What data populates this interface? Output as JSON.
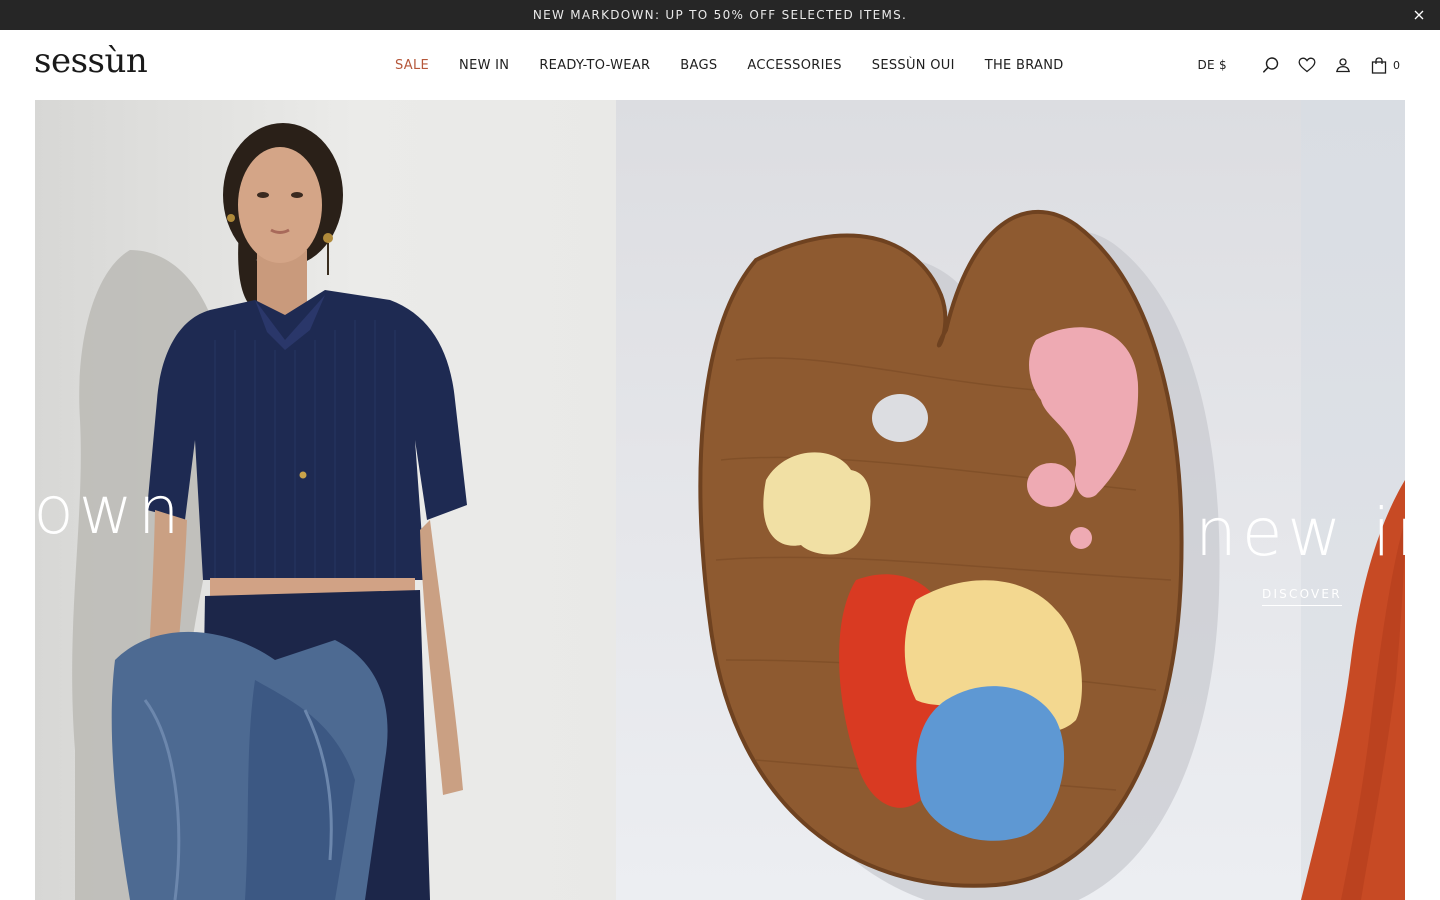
{
  "announcement": {
    "text": "NEW MARKDOWN: UP TO 50% OFF SELECTED ITEMS.",
    "close_icon": "close-icon"
  },
  "header": {
    "logo": "sessùn",
    "nav": [
      {
        "label": "SALE",
        "color": "#b5573a"
      },
      {
        "label": "NEW IN"
      },
      {
        "label": "READY-TO-WEAR"
      },
      {
        "label": "BAGS"
      },
      {
        "label": "ACCESSORIES"
      },
      {
        "label": "SESSÙN OUI"
      },
      {
        "label": "THE BRAND"
      }
    ],
    "locale": "DE $",
    "icons": [
      "search-icon",
      "heart-icon",
      "account-icon",
      "bag-icon"
    ],
    "cart_count": "0"
  },
  "hero": {
    "slides": [
      {
        "title": "lown",
        "image": "model-navy-shirt-denim"
      },
      {
        "image": "wooden-paint-palette"
      },
      {
        "title": "new in",
        "cta": "DISCOVER",
        "image": "model-orange-sleeve"
      }
    ]
  }
}
